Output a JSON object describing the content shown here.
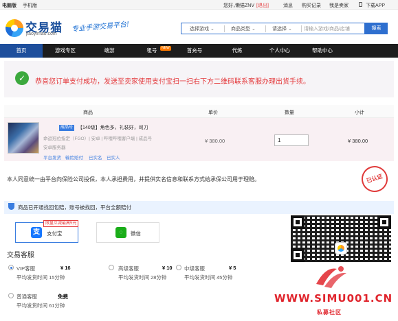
{
  "topbar": {
    "links_left": [
      "电脑版",
      "手机版"
    ],
    "greeting": "您好，",
    "username": "懒猫ZNV",
    "logout": "[退出]",
    "links_right": [
      "消息",
      "购买记录",
      "我是卖家",
      "下载APP"
    ]
  },
  "header": {
    "logo_text": "交易猫",
    "logo_domain": "jiaoyimao.com",
    "slogan": "专业手游交易平台!",
    "search": {
      "selects": [
        "选择游戏",
        "商品类型",
        "请选择"
      ],
      "placeholder": "请输入游戏/商品/店铺",
      "button_label": "搜索"
    }
  },
  "nav": {
    "items": [
      "首页",
      "游戏专区",
      "端游",
      "租号",
      "首充号",
      "代练",
      "个人中心",
      "帮助中心"
    ],
    "active_index": 0,
    "hot_badge": "NEW"
  },
  "success": {
    "message": "恭喜您订单支付成功，发送至卖家使用支付宝扫一扫右下方二维码联系客服办理出货手续。"
  },
  "order": {
    "headers": [
      "商品",
      "单价",
      "数量",
      "小计"
    ],
    "product": {
      "category_badge": "成品号",
      "title": "【140级】角色多，礼装好，司刀",
      "meta": "命运冠位指定（FGO）| 安卓 | 哔哩哔哩客户端 | 成品号",
      "server": "安卓服务器",
      "tags": [
        "平台发货",
        "输险赔付",
        "已实名",
        "已实人"
      ],
      "unit_price": "¥ 380.00",
      "quantity": "1",
      "subtotal": "¥ 380.00"
    }
  },
  "agreement": {
    "text": "本人同意统一由平台向保险公司投保，本人承担费用，并提供实名信息和联系方式给承保公司用于理赔。",
    "stamp": "已认证"
  },
  "insurance": {
    "text": "商品已开通找回包赔，账号被找回，平台全额赔付"
  },
  "payment": {
    "methods": [
      {
        "label": "支付宝",
        "icon": "alipay-icon",
        "selected": true
      },
      {
        "label": "微信",
        "icon": "wechat-icon",
        "selected": false
      }
    ],
    "promo": "限量立减最高5元"
  },
  "customer_service": {
    "title": "交易客服",
    "options": [
      {
        "name": "VIP客服",
        "price": "¥ 16",
        "time": "平均发货时间 15分钟",
        "selected": true
      },
      {
        "name": "高级客服",
        "price": "¥ 10",
        "time": "平均发货时间 28分钟",
        "selected": false
      },
      {
        "name": "中级客服",
        "price": "¥ 5",
        "time": "平均发货时间 45分钟",
        "selected": false
      },
      {
        "name": "普通客服",
        "price": "免费",
        "time": "平均发货时间 61分钟",
        "selected": false
      }
    ]
  },
  "watermark": {
    "url": "WWW.SIMU001.CN",
    "sub": "私募社区"
  },
  "colors": {
    "brand_blue": "#2e6fcf",
    "nav_active": "#1e4f9c",
    "alert_red": "#e4393c",
    "success_green": "#3ca93e"
  }
}
